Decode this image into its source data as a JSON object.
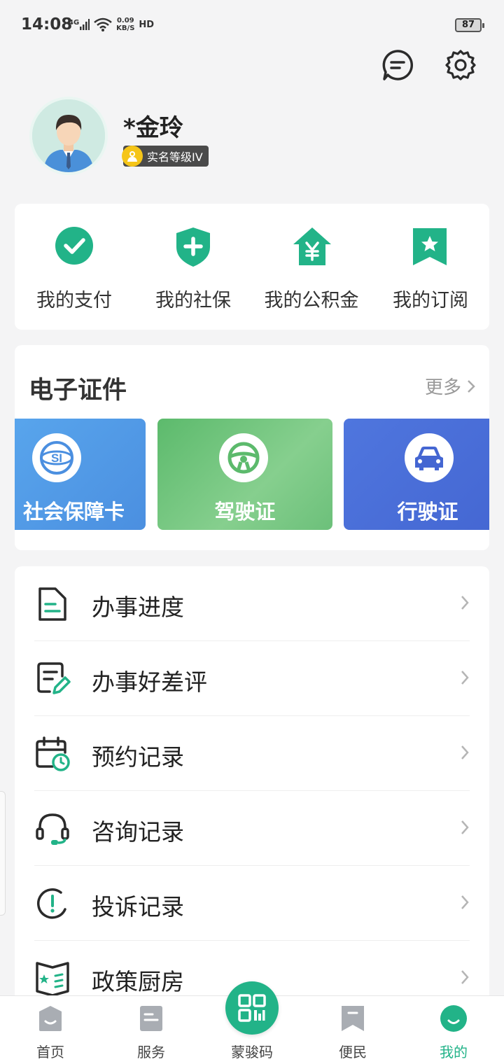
{
  "status_bar": {
    "time": "14:08",
    "network": "4G",
    "speed_value": "0.09",
    "speed_unit": "KB/S",
    "hd": "HD",
    "battery": "87"
  },
  "header": {
    "icons": [
      "message-icon",
      "settings-icon"
    ]
  },
  "profile": {
    "name": "*金玲",
    "verify_level": "实名等级IV"
  },
  "quick_links": [
    {
      "label": "我的支付",
      "icon": "check-circle-icon"
    },
    {
      "label": "我的社保",
      "icon": "shield-plus-icon"
    },
    {
      "label": "我的公积金",
      "icon": "house-yen-icon"
    },
    {
      "label": "我的订阅",
      "icon": "bookmark-star-icon"
    }
  ],
  "certificates": {
    "title": "电子证件",
    "more": "更多",
    "items": [
      {
        "label": "社会保障卡",
        "icon": "social-security-icon",
        "color": "#4d9de8"
      },
      {
        "label": "驾驶证",
        "icon": "steering-wheel-icon",
        "color": "#6cc07a"
      },
      {
        "label": "行驶证",
        "icon": "car-icon",
        "color": "#4a6fd8"
      }
    ]
  },
  "menu": [
    {
      "label": "办事进度",
      "icon": "document-icon"
    },
    {
      "label": "办事好差评",
      "icon": "review-edit-icon"
    },
    {
      "label": "预约记录",
      "icon": "calendar-clock-icon"
    },
    {
      "label": "咨询记录",
      "icon": "headset-icon"
    },
    {
      "label": "投诉记录",
      "icon": "alert-circle-icon"
    },
    {
      "label": "政策厨房",
      "icon": "policy-book-icon"
    }
  ],
  "bottom_nav": [
    {
      "label": "首页",
      "icon": "home-icon"
    },
    {
      "label": "服务",
      "icon": "service-icon"
    },
    {
      "label": "蒙骏码",
      "icon": "qr-code-icon"
    },
    {
      "label": "便民",
      "icon": "bookmark-icon"
    },
    {
      "label": "我的",
      "icon": "profile-icon",
      "active": true
    }
  ],
  "colors": {
    "accent": "#22b388",
    "background": "#f4f4f5"
  }
}
